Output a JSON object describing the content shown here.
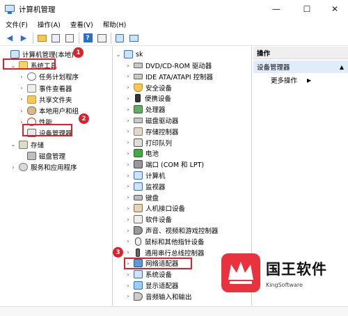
{
  "window": {
    "title": "计算机管理"
  },
  "menu": [
    "文件(F)",
    "操作(A)",
    "查看(V)",
    "帮助(H)"
  ],
  "left_tree": [
    {
      "label": "计算机管理(本地)",
      "indent": 0,
      "arrow": "",
      "icon": "monitor"
    },
    {
      "label": "系统工具",
      "indent": 1,
      "arrow": "⌄",
      "icon": "tools"
    },
    {
      "label": "任务计划程序",
      "indent": 2,
      "arrow": "›",
      "icon": "clock"
    },
    {
      "label": "事件查看器",
      "indent": 2,
      "arrow": "›",
      "icon": "log"
    },
    {
      "label": "共享文件夹",
      "indent": 2,
      "arrow": "›",
      "icon": "folder"
    },
    {
      "label": "本地用户和组",
      "indent": 2,
      "arrow": "›",
      "icon": "users"
    },
    {
      "label": "性能",
      "indent": 2,
      "arrow": "›",
      "icon": "perf"
    },
    {
      "label": "设备管理器",
      "indent": 2,
      "arrow": "",
      "icon": "dev"
    },
    {
      "label": "存储",
      "indent": 1,
      "arrow": "⌄",
      "icon": "store"
    },
    {
      "label": "磁盘管理",
      "indent": 2,
      "arrow": "",
      "icon": "disk"
    },
    {
      "label": "服务和应用程序",
      "indent": 1,
      "arrow": "›",
      "icon": "gear"
    }
  ],
  "device_tree": {
    "root": "sk",
    "items": [
      {
        "label": "DVD/CD-ROM 驱动器",
        "icon": "drive"
      },
      {
        "label": "IDE ATA/ATAPI 控制器",
        "icon": "drive"
      },
      {
        "label": "安全设备",
        "icon": "shield"
      },
      {
        "label": "便携设备",
        "icon": "phone"
      },
      {
        "label": "处理器",
        "icon": "chip"
      },
      {
        "label": "磁盘驱动器",
        "icon": "drive"
      },
      {
        "label": "存储控制器",
        "icon": "store"
      },
      {
        "label": "打印队列",
        "icon": "print"
      },
      {
        "label": "电池",
        "icon": "bat"
      },
      {
        "label": "端口 (COM 和 LPT)",
        "icon": "port"
      },
      {
        "label": "计算机",
        "icon": "pc"
      },
      {
        "label": "监视器",
        "icon": "pc"
      },
      {
        "label": "键盘",
        "icon": "kbd"
      },
      {
        "label": "人机接口设备",
        "icon": "hid"
      },
      {
        "label": "软件设备",
        "icon": "soft"
      },
      {
        "label": "声音、视频和游戏控制器",
        "icon": "snd"
      },
      {
        "label": "鼠标和其他指针设备",
        "icon": "mouse"
      },
      {
        "label": "通用串行总线控制器",
        "icon": "usb"
      },
      {
        "label": "网络适配器",
        "icon": "net"
      },
      {
        "label": "系统设备",
        "icon": "sys"
      },
      {
        "label": "显示适配器",
        "icon": "disp"
      },
      {
        "label": "音频输入和输出",
        "icon": "audio"
      }
    ]
  },
  "actions": {
    "header": "操作",
    "selected": "设备管理器",
    "more": "更多操作"
  },
  "badges": [
    "1",
    "2",
    "3"
  ],
  "watermark": {
    "cn": "国王软件",
    "en": "KingSoftware"
  },
  "colors": {
    "highlight": "#e21f26",
    "selection": "#e1ecfa",
    "accent": "#2a6fc9"
  }
}
